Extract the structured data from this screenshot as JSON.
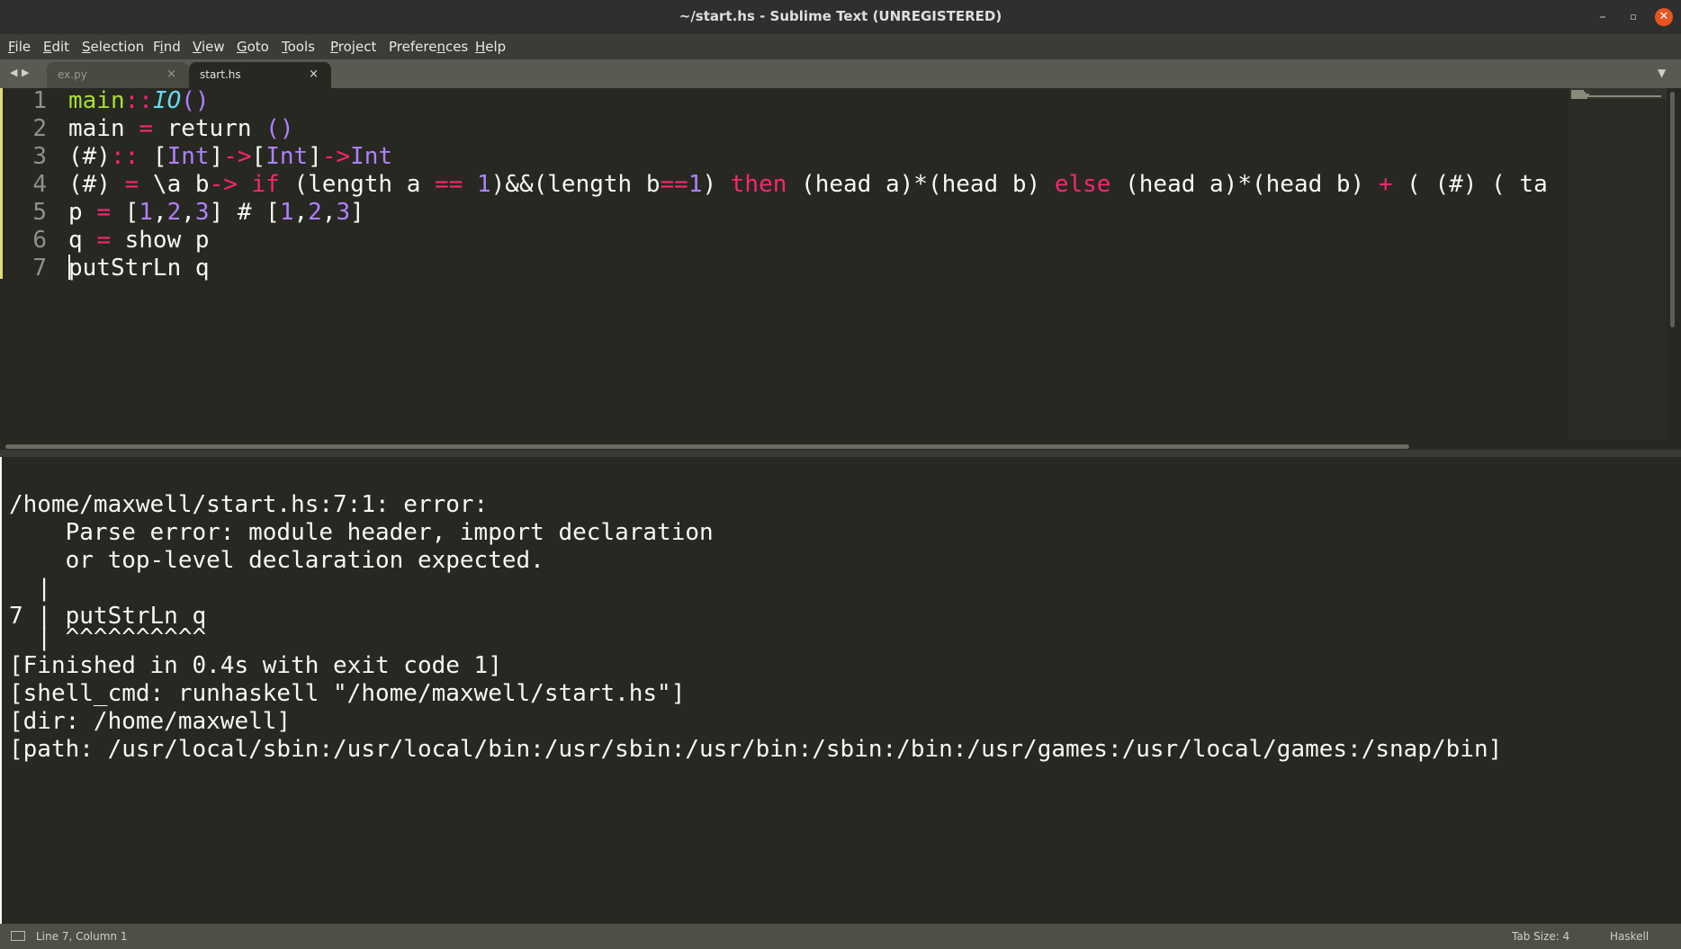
{
  "window": {
    "title": "~/start.hs - Sublime Text (UNREGISTERED)",
    "controls": {
      "minimize": "–",
      "maximize": "▫",
      "close": "✕"
    }
  },
  "menu": [
    {
      "pre": "",
      "ul": "F",
      "post": "ile"
    },
    {
      "pre": "",
      "ul": "E",
      "post": "dit"
    },
    {
      "pre": "",
      "ul": "S",
      "post": "election"
    },
    {
      "pre": "F",
      "ul": "i",
      "post": "nd"
    },
    {
      "pre": "",
      "ul": "V",
      "post": "iew"
    },
    {
      "pre": "",
      "ul": "G",
      "post": "oto"
    },
    {
      "pre": "",
      "ul": "T",
      "post": "ools"
    },
    {
      "pre": "",
      "ul": "P",
      "post": "roject"
    },
    {
      "pre": "Prefere",
      "ul": "n",
      "post": "ces"
    },
    {
      "pre": "",
      "ul": "H",
      "post": "elp"
    }
  ],
  "tabs": [
    {
      "label": "ex.py",
      "active": false
    },
    {
      "label": "start.hs",
      "active": true
    }
  ],
  "editor": {
    "line_numbers": [
      "1",
      "2",
      "3",
      "4",
      "5",
      "6",
      "7"
    ],
    "lines": [
      [
        [
          "fn",
          "main"
        ],
        [
          "kw",
          "::"
        ],
        [
          "ty",
          "IO"
        ],
        [
          "pu",
          "()"
        ]
      ],
      [
        [
          "pl",
          "main "
        ],
        [
          "kw",
          "="
        ],
        [
          "pl",
          " return "
        ],
        [
          "pu",
          "()"
        ]
      ],
      [
        [
          "pl",
          "(#)"
        ],
        [
          "kw",
          "::"
        ],
        [
          "pl",
          " ["
        ],
        [
          "pu",
          "Int"
        ],
        [
          "pl",
          "]"
        ],
        [
          "kw",
          "->"
        ],
        [
          "pl",
          "["
        ],
        [
          "pu",
          "Int"
        ],
        [
          "pl",
          "]"
        ],
        [
          "kw",
          "->"
        ],
        [
          "pu",
          "Int"
        ]
      ],
      [
        [
          "pl",
          "(#) "
        ],
        [
          "kw",
          "="
        ],
        [
          "pl",
          " \\a b"
        ],
        [
          "kw",
          "->"
        ],
        [
          "pl",
          " "
        ],
        [
          "kw",
          "if"
        ],
        [
          "pl",
          " (length a "
        ],
        [
          "kw",
          "=="
        ],
        [
          "pl",
          " "
        ],
        [
          "pu",
          "1"
        ],
        [
          "pl",
          ")&&(length b"
        ],
        [
          "kw",
          "=="
        ],
        [
          "pu",
          "1"
        ],
        [
          "pl",
          ") "
        ],
        [
          "kw",
          "then"
        ],
        [
          "pl",
          " (head a)*(head b) "
        ],
        [
          "kw",
          "else"
        ],
        [
          "pl",
          " (head a)*(head b) "
        ],
        [
          "kw",
          "+"
        ],
        [
          "pl",
          " ( (#) ( ta"
        ]
      ],
      [
        [
          "pl",
          "p "
        ],
        [
          "kw",
          "="
        ],
        [
          "pl",
          " ["
        ],
        [
          "pu",
          "1"
        ],
        [
          "pl",
          ","
        ],
        [
          "pu",
          "2"
        ],
        [
          "pl",
          ","
        ],
        [
          "pu",
          "3"
        ],
        [
          "pl",
          "] # ["
        ],
        [
          "pu",
          "1"
        ],
        [
          "pl",
          ","
        ],
        [
          "pu",
          "2"
        ],
        [
          "pl",
          ","
        ],
        [
          "pu",
          "3"
        ],
        [
          "pl",
          "]"
        ]
      ],
      [
        [
          "pl",
          "q "
        ],
        [
          "kw",
          "="
        ],
        [
          "pl",
          " show p"
        ]
      ],
      [
        [
          "pl",
          "putStrLn q"
        ]
      ]
    ]
  },
  "output": {
    "lines": [
      "/home/maxwell/start.hs:7:1: error:",
      "    Parse error: module header, import declaration",
      "    or top-level declaration expected.",
      "  |",
      "7 | putStrLn q",
      "  | ^^^^^^^^^^",
      "[Finished in 0.4s with exit code 1]",
      "[shell_cmd: runhaskell \"/home/maxwell/start.hs\"]",
      "[dir: /home/maxwell]",
      "[path: /usr/local/sbin:/usr/local/bin:/usr/sbin:/usr/bin:/sbin:/bin:/usr/games:/usr/local/games:/snap/bin]"
    ]
  },
  "status": {
    "position": "Line 7, Column 1",
    "tab_size": "Tab Size: 4",
    "syntax": "Haskell"
  },
  "colors": {
    "background": "#272822",
    "foreground": "#f8f8f2",
    "keyword": "#f92672",
    "function": "#a6e22e",
    "type": "#66d9ef",
    "constant": "#ae81ff",
    "close_button": "#e95420"
  }
}
